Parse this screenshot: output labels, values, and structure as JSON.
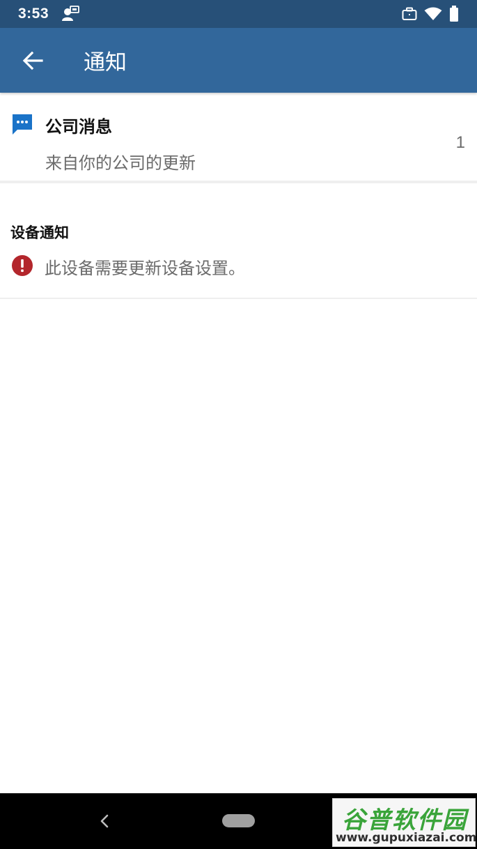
{
  "status_bar": {
    "time": "3:53",
    "icons": [
      "account-badge-icon",
      "briefcase-icon",
      "wifi-icon",
      "battery-icon"
    ]
  },
  "app_bar": {
    "title": "通知",
    "back_icon": "arrow-left-icon"
  },
  "company_messages": {
    "icon": "chat-bubble-icon",
    "title": "公司消息",
    "subtitle": "来自你的公司的更新",
    "count": "1"
  },
  "device_notifications": {
    "header": "设备通知",
    "items": [
      {
        "icon": "alert-circle-icon",
        "text": "此设备需要更新设备设置。"
      }
    ]
  },
  "watermark": {
    "text": "谷普软件园",
    "url": "www.gupuxiazai.com"
  },
  "colors": {
    "status_bar": "#275078",
    "app_bar": "#32679b",
    "chat_icon": "#1a73c8",
    "alert_icon": "#b3262c"
  }
}
